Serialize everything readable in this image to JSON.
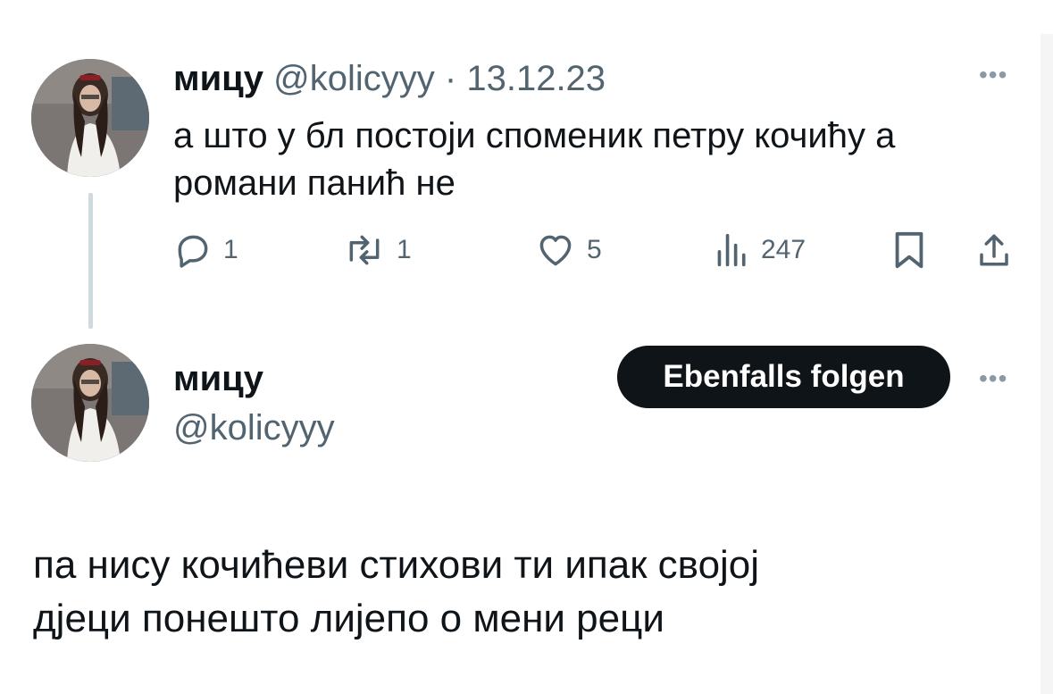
{
  "colors": {
    "text": "#0f1419",
    "muted": "#536471",
    "button_bg": "#0f1419",
    "button_text": "#ffffff",
    "thread_line": "#cfd9de"
  },
  "post1": {
    "avatar_icon": "profile-photo",
    "name": "мицу",
    "handle": "@kolicyyy",
    "separator": "·",
    "date": "13.12.23",
    "more_icon": "more-horizontal-icon",
    "text_line1": "а што у бл постоји споменик петру кочићу а",
    "text_line2": "романи панић не",
    "actions": {
      "reply": {
        "icon": "reply-icon",
        "count": "1"
      },
      "repost": {
        "icon": "repost-icon",
        "count": "1"
      },
      "like": {
        "icon": "heart-icon",
        "count": "5"
      },
      "views": {
        "icon": "views-icon",
        "count": "247"
      },
      "bookmark": {
        "icon": "bookmark-icon"
      },
      "share": {
        "icon": "share-icon"
      }
    }
  },
  "post2": {
    "avatar_icon": "profile-photo",
    "name": "мицу",
    "handle": "@kolicyyy",
    "follow_label": "Ebenfalls folgen",
    "more_icon": "more-horizontal-icon",
    "text_line1": "па нису кочићеви стихови ти ипак својој",
    "text_line2": "дјеци понешто лијепо о мени реци"
  }
}
